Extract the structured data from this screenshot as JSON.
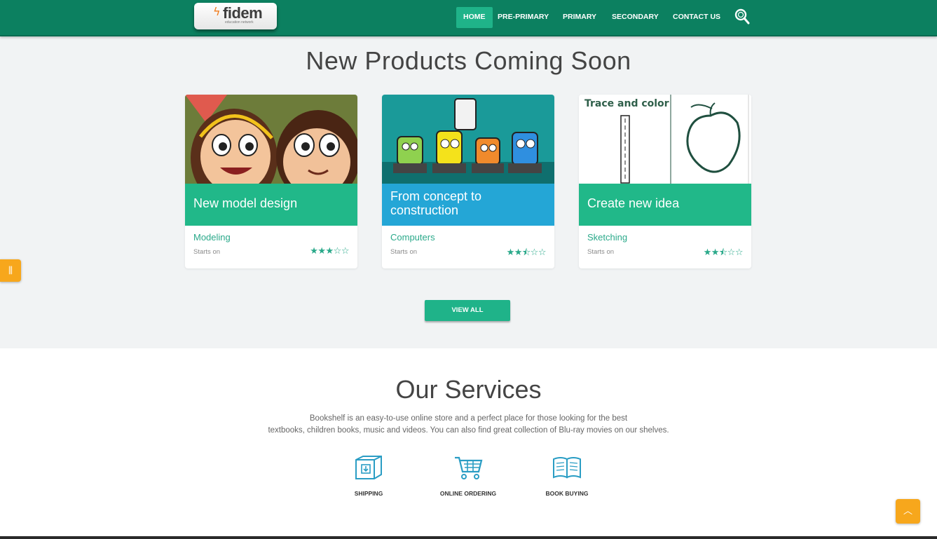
{
  "header": {
    "logo": {
      "wordmark": "fidem",
      "tagline": "education network"
    },
    "nav": [
      {
        "label": "HOME",
        "active": true
      },
      {
        "label": "PRE-PRIMARY",
        "active": false
      },
      {
        "label": "PRIMARY",
        "active": false
      },
      {
        "label": "SECONDARY",
        "active": false
      },
      {
        "label": "CONTACT US",
        "active": false
      }
    ],
    "search_icon": "search-icon"
  },
  "products": {
    "title": "New Products Coming Soon",
    "cards": [
      {
        "band_title": "New model design",
        "band_color": "#21b889",
        "category": "Modeling",
        "starts_label": "Starts on",
        "rating": 3,
        "rating_max": 5,
        "image": "cartoon-kids"
      },
      {
        "band_title": "From concept to construction",
        "band_color": "#24a6d6",
        "category": "Computers",
        "starts_label": "Starts on",
        "rating": 2.5,
        "rating_max": 5,
        "image": "cartoon-computers"
      },
      {
        "band_title": "Create new idea",
        "band_color": "#21b889",
        "category": "Sketching",
        "starts_label": "Starts on",
        "rating": 2.5,
        "rating_max": 5,
        "image": "trace-and-color-sheet",
        "image_caption": "Trace and color"
      }
    ],
    "view_all": "VIEW ALL"
  },
  "services": {
    "title": "Our Services",
    "description_line1": "Bookshelf is an easy-to-use online store and a perfect place for those looking for the best",
    "description_line2": "textbooks, children books, music and videos. You can also find great collection of Blu-ray movies on our shelves.",
    "items": [
      {
        "label": "SHIPPING",
        "icon": "box-download-icon"
      },
      {
        "label": "ONLINE ORDERING",
        "icon": "cart-icon"
      },
      {
        "label": "BOOK BUYING",
        "icon": "open-book-icon"
      }
    ]
  },
  "colors": {
    "header": "#0c8060",
    "accent": "#1fb389",
    "accent_blue": "#24a6d6",
    "widget": "#f7a71c"
  }
}
